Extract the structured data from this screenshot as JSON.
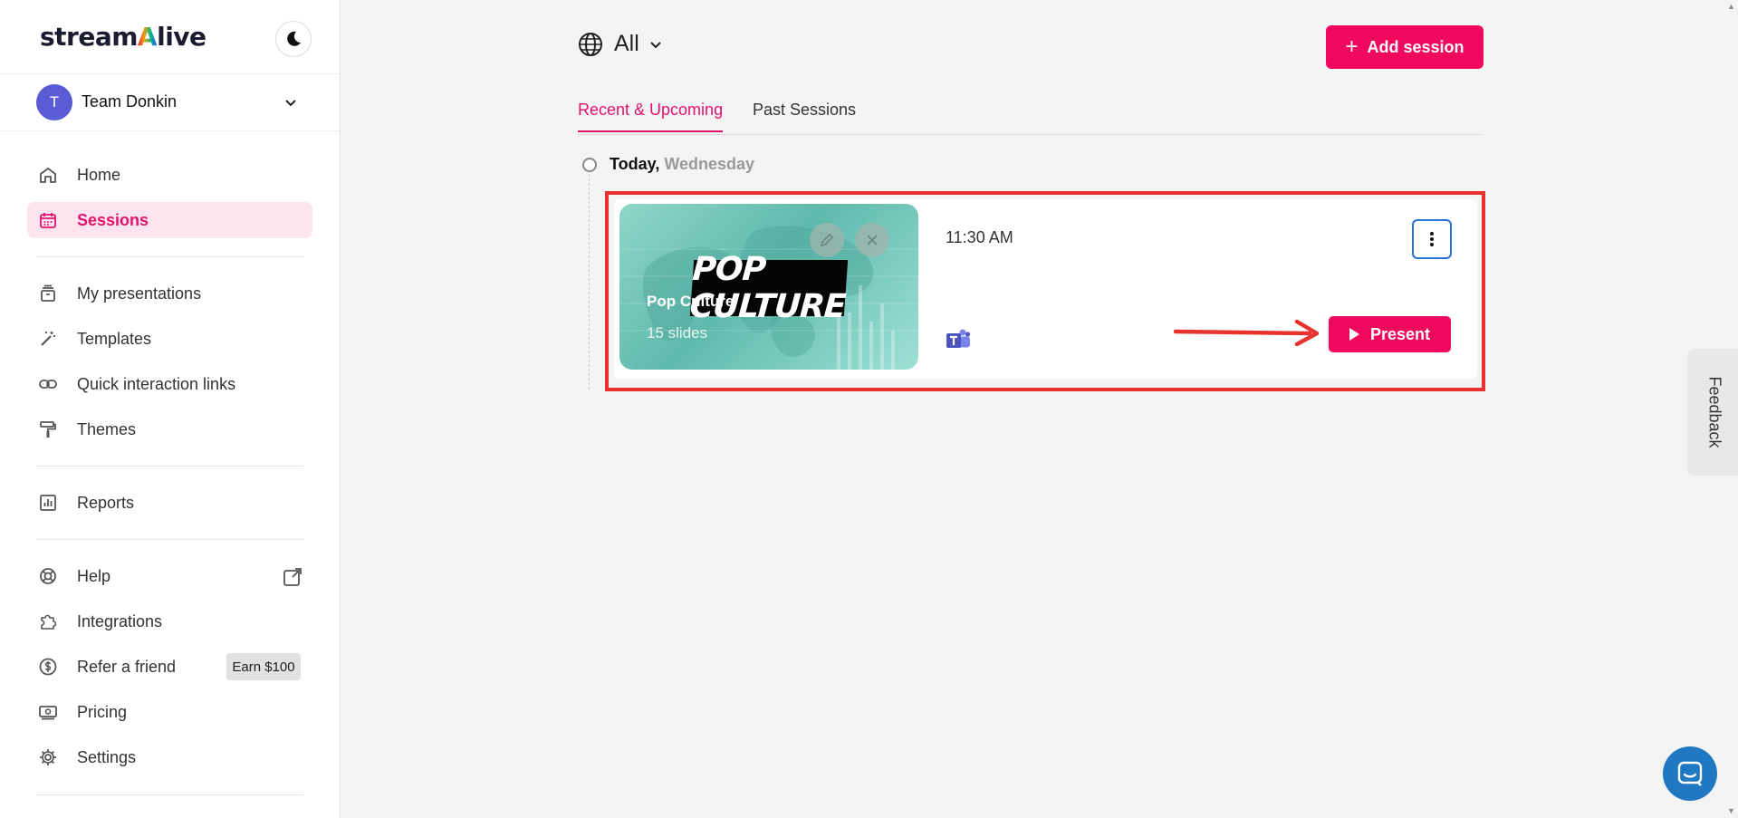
{
  "brand": {
    "logo_pre": "stream",
    "logo_mid": "A",
    "logo_post": "live"
  },
  "team": {
    "initial": "T",
    "name": "Team Donkin"
  },
  "sidebar": {
    "items": [
      {
        "label": "Home",
        "icon": "home-icon"
      },
      {
        "label": "Sessions",
        "icon": "calendar-icon",
        "active": true
      },
      {
        "label": "My presentations",
        "icon": "archive-icon"
      },
      {
        "label": "Templates",
        "icon": "magic-wand-icon"
      },
      {
        "label": "Quick interaction links",
        "icon": "link-icon"
      },
      {
        "label": "Themes",
        "icon": "paint-roller-icon"
      },
      {
        "label": "Reports",
        "icon": "bar-chart-icon"
      },
      {
        "label": "Help",
        "icon": "lifebuoy-icon"
      },
      {
        "label": "Integrations",
        "icon": "puzzle-icon"
      },
      {
        "label": "Refer a friend",
        "icon": "dollar-icon"
      },
      {
        "label": "Pricing",
        "icon": "cash-icon"
      },
      {
        "label": "Settings",
        "icon": "gear-icon"
      }
    ],
    "earn_badge": "Earn $100"
  },
  "header": {
    "filter_label": "All",
    "add_session_label": "Add session"
  },
  "tabs": [
    "Recent & Upcoming",
    "Past Sessions"
  ],
  "timeline": {
    "day": "Today,",
    "weekday": "Wednesday"
  },
  "session": {
    "thumbnail_text": "POP CULTURE",
    "title": "Pop Culture",
    "slides": "15 slides",
    "time": "11:30 AM",
    "platform_icon": "microsoft-teams-icon",
    "present_label": "Present"
  },
  "feedback_label": "Feedback",
  "colors": {
    "accent": "#f0085f",
    "highlight": "#e8322d",
    "active_bg": "#fde4ee"
  }
}
